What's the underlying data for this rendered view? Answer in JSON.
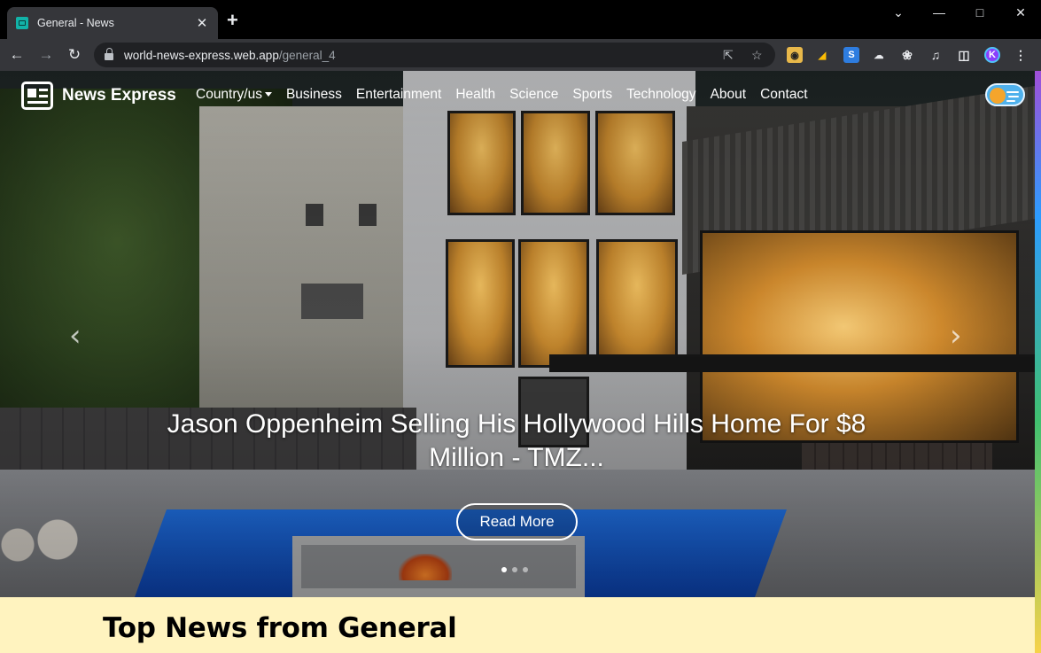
{
  "browser": {
    "tab_title": "General - News",
    "tab_close": "✕",
    "new_tab": "+",
    "url_host": "world-news-express.web.app",
    "url_path": "/general_4"
  },
  "site": {
    "brand": "News Express",
    "nav": {
      "country": "Country/us",
      "business": "Business",
      "entertainment": "Entertainment",
      "health": "Health",
      "science": "Science",
      "sports": "Sports",
      "technology": "Technology",
      "about": "About",
      "contact": "Contact"
    }
  },
  "carousel": {
    "caption": "Jason Oppenheim Selling His Hollywood Hills Home For $8 Million - TMZ...",
    "button": "Read More",
    "prev": "‹",
    "next": "›",
    "slide_count": 3,
    "active_slide": 1
  },
  "section": {
    "title": "Top News from General"
  },
  "colors": {
    "page_background": "#fff3bf",
    "toggle": "#4fb1ec"
  }
}
